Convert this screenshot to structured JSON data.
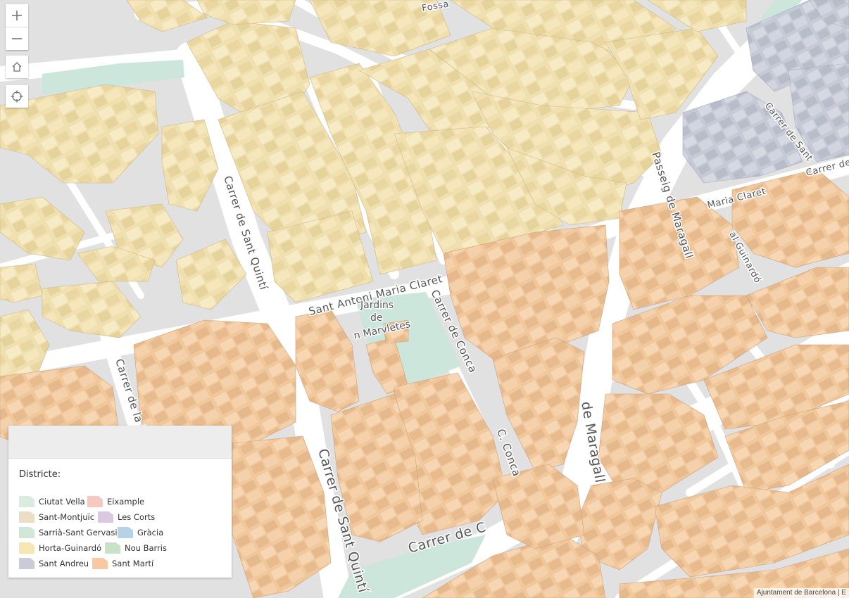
{
  "map": {
    "street_labels": {
      "sant_quinti_upper": "Carrer de Sant Quintí",
      "sant_quinti_lower": "Carrer de  Sant Quintí",
      "antoni_maria_claret": "Sant Antoni Maria Claret",
      "conca_upper": "Carrer de Conca",
      "conca_lower": "C. Conca",
      "maragall_upper": "Passeig de Maragall",
      "maragall_lower": "de Maragall",
      "carrer_de_bottom": "Carrer de  C",
      "carrer_de_left": "Carrer de la In",
      "maria_claret_right": "Maria Claret",
      "guinardo_right": "al Guinardó",
      "carrer_de_right": "Carrer de",
      "sant_antoni_right": "Carrer de Sant",
      "fossar_top": "Fossa"
    },
    "park_label": {
      "line1": "Jardins",
      "line2": "de",
      "line3": "n Marvletes"
    },
    "colors": {
      "horta_guinardo": "#f0e0b0",
      "sant_marti": "#f2c9a0",
      "sant_andreu": "#c6cad6",
      "park": "#cde6dc",
      "street": "#ffffff",
      "block": "#e1e1e1"
    }
  },
  "controls": {
    "zoom_in_icon": "plus-icon",
    "zoom_out_icon": "minus-icon",
    "home_icon": "home-icon",
    "locate_icon": "crosshair-icon"
  },
  "legend": {
    "title": "Districte:",
    "items": [
      {
        "label": "Ciutat Vella",
        "color": "#d9ecdd"
      },
      {
        "label": "Eixample",
        "color": "#f6c8c0"
      },
      {
        "label": "Sant-Montjuïc",
        "color": "#eddcc6"
      },
      {
        "label": "Les Corts",
        "color": "#d8c8e2"
      },
      {
        "label": "Sarrià-Sant Gervasi",
        "color": "#cfe6d8"
      },
      {
        "label": "Gràcia",
        "color": "#b6d3e6"
      },
      {
        "label": "Horta-Guinardó",
        "color": "#f6e6b4"
      },
      {
        "label": "Nou Barris",
        "color": "#c8e2c8"
      },
      {
        "label": "Sant Andreu",
        "color": "#c9ccd6"
      },
      {
        "label": "Sant Martí",
        "color": "#f6c9a2"
      }
    ]
  },
  "attribution": "Ajuntament de Barcelona | E"
}
